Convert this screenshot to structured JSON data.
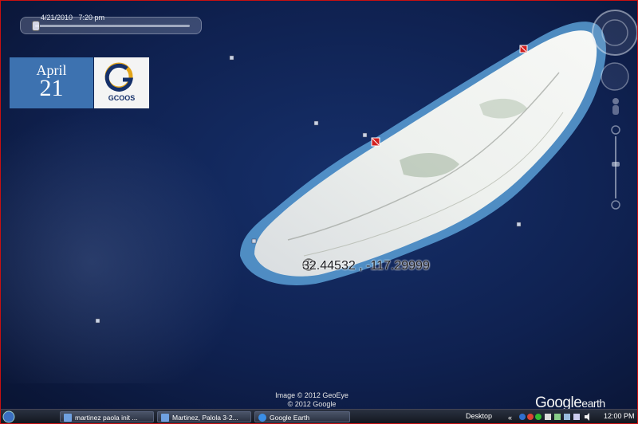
{
  "timeline": {
    "label": "4/21/2010   7:20 pm"
  },
  "badge": {
    "month": "April",
    "day": "21",
    "logo_text": "GCOOS"
  },
  "map": {
    "coordinates": "32.44532 , -117.29999",
    "credit_line1": "Image © 2012 GeoEye",
    "credit_line2": "© 2012 Google",
    "brand": "Google",
    "brand_suffix": "earth"
  },
  "taskbar": {
    "buttons": [
      {
        "label": "martinez paola init ..."
      },
      {
        "label": "Martinez, Palola 3-2..."
      },
      {
        "label": "Google Earth"
      }
    ],
    "desktop_label": "Desktop",
    "clock": "12:00 PM"
  },
  "colors": {
    "frame": "#c81010",
    "ocean": "#0d1a3a",
    "date_badge": "#3d72b0",
    "marker": "#d21f1f"
  }
}
